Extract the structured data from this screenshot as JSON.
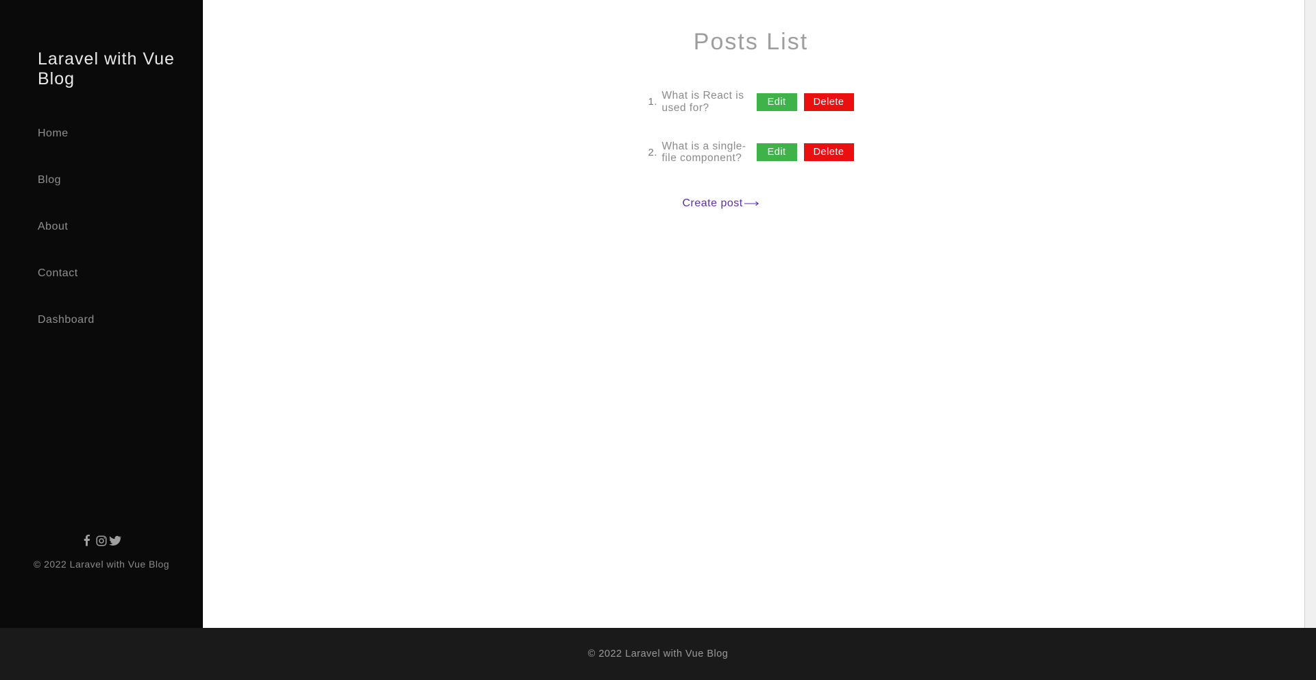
{
  "sidebar": {
    "brand": "Laravel with Vue Blog",
    "nav": [
      "Home",
      "Blog",
      "About",
      "Contact",
      "Dashboard"
    ],
    "copyright": "© 2022 Laravel with Vue Blog"
  },
  "main": {
    "title": "Posts List",
    "posts": [
      {
        "num": "1.",
        "title": "What is React is used for?"
      },
      {
        "num": "2.",
        "title": "What is a single-file component?"
      }
    ],
    "buttons": {
      "edit": "Edit",
      "delete": "Delete"
    },
    "create_label": "Create post"
  },
  "footer": {
    "copyright": "© 2022 Laravel with Vue Blog"
  }
}
